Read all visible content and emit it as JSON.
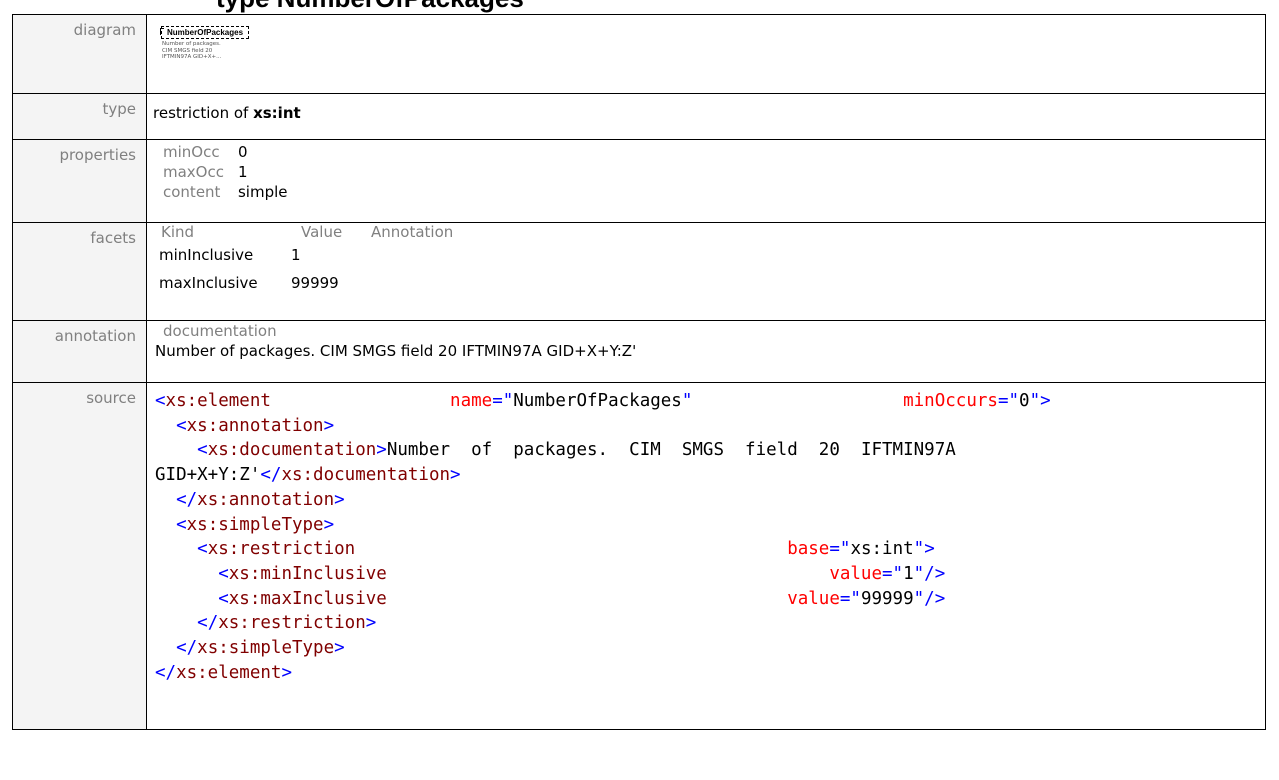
{
  "header": {
    "title_fragment": "type NumberOfPackages"
  },
  "rows": {
    "diagram": {
      "label": "diagram",
      "element_name": "NumberOfPackages",
      "description_lines": [
        "Number of packages.",
        "CIM SMGS field 20",
        "IFTMIN97A  GID+X+..."
      ]
    },
    "type": {
      "label": "type",
      "prefix": "restriction of ",
      "base": "xs:int"
    },
    "properties": {
      "label": "properties",
      "items": [
        {
          "key": "minOcc",
          "value": "0"
        },
        {
          "key": "maxOcc",
          "value": "1"
        },
        {
          "key": "content",
          "value": "simple"
        }
      ]
    },
    "facets": {
      "label": "facets",
      "headers": [
        "Kind",
        "Value",
        "Annotation"
      ],
      "items": [
        {
          "kind": "minInclusive",
          "value": "1"
        },
        {
          "kind": "maxInclusive",
          "value": "99999"
        }
      ]
    },
    "annotation": {
      "label": "annotation",
      "header": "documentation",
      "text": "Number of packages. CIM SMGS field 20 IFTMIN97A  GID+X+Y:Z'"
    },
    "source": {
      "label": "source",
      "element_tag": "xs:element",
      "name_attr": "name",
      "name_val": "NumberOfPackages",
      "minoccurs_attr": "minOccurs",
      "minoccurs_val": "0",
      "annotation_tag": "xs:annotation",
      "documentation_tag": "xs:documentation",
      "doc_text_1": "Number  of  packages.  CIM  SMGS  field  20  IFTMIN97A",
      "doc_text_2": "GID+X+Y:Z'",
      "simpletype_tag": "xs:simpleType",
      "restriction_tag": "xs:restriction",
      "base_attr": "base",
      "base_val": "xs:int",
      "mininclusive_tag": "xs:minInclusive",
      "maxinclusive_tag": "xs:maxInclusive",
      "value_attr": "value",
      "min_val": "1",
      "max_val": "99999"
    }
  }
}
